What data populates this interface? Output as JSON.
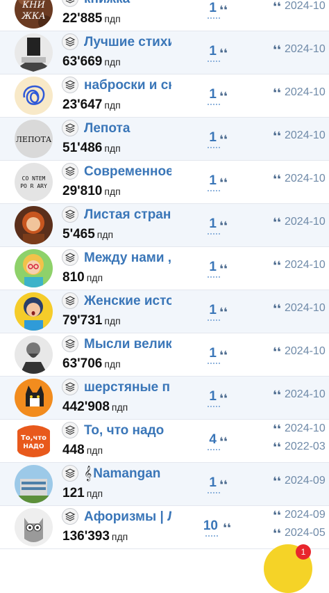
{
  "unit_label": "пдп",
  "quote_glyph": "❛❛",
  "channels": [
    {
      "title": "книжка",
      "subscribers": "22'885",
      "count": "1",
      "dates": [
        "2024-10"
      ],
      "avatar": "knizhka-logo",
      "avatar_text": [
        "КНИ",
        "ЖКА"
      ]
    },
    {
      "title": "Лучшие стихи",
      "subscribers": "63'669",
      "count": "1",
      "dates": [
        "2024-10"
      ],
      "avatar": "book-reader-photo"
    },
    {
      "title": "наброски и сн",
      "subscribers": "23'647",
      "count": "1",
      "dates": [
        "2024-10"
      ],
      "avatar": "blue-scribble"
    },
    {
      "title": "Лепота",
      "subscribers": "51'486",
      "count": "1",
      "dates": [
        "2024-10"
      ],
      "avatar": "lepota-logo",
      "avatar_text": [
        "ЛЕПОТА"
      ]
    },
    {
      "title": "Современное",
      "subscribers": "29'810",
      "count": "1",
      "dates": [
        "2024-10"
      ],
      "avatar": "contemporary-logo",
      "avatar_text": [
        "CO NTEM",
        "PO R ARY"
      ]
    },
    {
      "title": "Листая стран",
      "subscribers": "5'465",
      "count": "1",
      "dates": [
        "2024-10"
      ],
      "avatar": "red-haired-girl-portrait"
    },
    {
      "title": "Между нами ,",
      "subscribers": "810",
      "count": "1",
      "dates": [
        "2024-10"
      ],
      "avatar": "woman-with-glasses"
    },
    {
      "title": "Женские исто",
      "subscribers": "79'731",
      "count": "1",
      "dates": [
        "2024-10"
      ],
      "avatar": "surprised-woman"
    },
    {
      "title": "Мысли велик",
      "subscribers": "63'706",
      "count": "1",
      "dates": [
        "2024-10"
      ],
      "avatar": "chekhov-portrait"
    },
    {
      "title": "шерстяные п",
      "subscribers": "442'908",
      "count": "1",
      "dates": [
        "2024-10"
      ],
      "avatar": "cat-orange"
    },
    {
      "title": "То, что надо",
      "subscribers": "448",
      "count": "4",
      "dates": [
        "2024-10",
        "2022-03"
      ],
      "avatar": "to-chto-nado-logo",
      "avatar_text": [
        "То,что",
        "НАДО"
      ]
    },
    {
      "title": "Namangan",
      "prefix_icon": "𝄞",
      "subscribers": "121",
      "count": "1",
      "dates": [
        "2024-09"
      ],
      "avatar": "building-photo"
    },
    {
      "title": "Афоризмы | Л",
      "subscribers": "136'393",
      "count": "10",
      "dates": [
        "2024-09",
        "2024-05"
      ],
      "avatar": "owl-illustration"
    }
  ],
  "floating_badge": {
    "count": "1"
  }
}
